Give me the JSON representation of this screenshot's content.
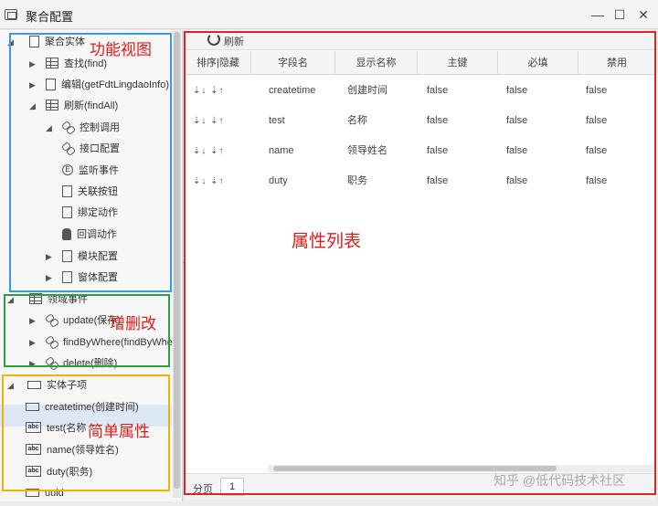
{
  "window": {
    "title": "聚合配置",
    "minimize_glyph": "—",
    "maximize_glyph": "☐",
    "close_glyph": "✕"
  },
  "tree": {
    "section1": {
      "label": "聚合实体",
      "icon": "entity-icon",
      "items": [
        {
          "label": "查找(find)",
          "icon": "table-icon"
        },
        {
          "label": "编辑(getFdtLingdaoInfo)",
          "icon": "doc-icon"
        },
        {
          "label": "刷新(findAll)",
          "icon": "table-icon"
        }
      ],
      "children": [
        {
          "label": "控制调用",
          "icon": "link-icon"
        },
        {
          "label": "接口配置",
          "icon": "link-icon"
        },
        {
          "label": "监听事件",
          "icon": "event-icon"
        },
        {
          "label": "关联按钮",
          "icon": "edit-icon"
        },
        {
          "label": "绑定动作",
          "icon": "edit-icon"
        },
        {
          "label": "回调动作",
          "icon": "hand-icon"
        },
        {
          "label": "模块配置",
          "icon": "edit-icon"
        },
        {
          "label": "窗体配置",
          "icon": "form-icon"
        }
      ]
    },
    "section2": {
      "label": "领域事件",
      "icon": "grid-icon",
      "items": [
        {
          "label": "update(保存)",
          "icon": "link-icon"
        },
        {
          "label": "findByWhere(findByWhe",
          "icon": "link-icon"
        },
        {
          "label": "delete(删除)",
          "icon": "link-icon"
        }
      ]
    },
    "section3": {
      "label": "实体子项",
      "icon": "field-icon",
      "items": [
        {
          "label": "createtime(创建时间)",
          "icon": "field-icon"
        },
        {
          "label": "test(名称",
          "icon": "abc-icon"
        },
        {
          "label": "name(领导姓名)",
          "icon": "abc-icon"
        },
        {
          "label": "duty(职务)",
          "icon": "abc-icon"
        },
        {
          "label": "uuid",
          "icon": "field-icon"
        }
      ]
    }
  },
  "annotations": {
    "function_view": "功能视图",
    "crud": "增删改",
    "simple_attrs": "简单属性",
    "attr_list": "属性列表"
  },
  "colors": {
    "blue": "#3a9bd8",
    "green": "#2ea043",
    "yellow": "#f0b400",
    "red": "#e02424"
  },
  "grid": {
    "refresh_label": "刷新",
    "headers": [
      "排序|隐藏",
      "字段名",
      "显示名称",
      "主键",
      "必填",
      "禁用"
    ],
    "sort_icons": "⇣↓ ⇣↑",
    "rows": [
      {
        "field": "createtime",
        "display": "创建时间",
        "pk": "false",
        "required": "false",
        "disabled": "false"
      },
      {
        "field": "test",
        "display": "名称",
        "pk": "false",
        "required": "false",
        "disabled": "false"
      },
      {
        "field": "name",
        "display": "领导姓名",
        "pk": "false",
        "required": "false",
        "disabled": "false"
      },
      {
        "field": "duty",
        "display": "职务",
        "pk": "false",
        "required": "false",
        "disabled": "false"
      }
    ],
    "pager_label": "分页",
    "page_number": "1"
  },
  "watermark": "知乎 @低代码技术社区"
}
